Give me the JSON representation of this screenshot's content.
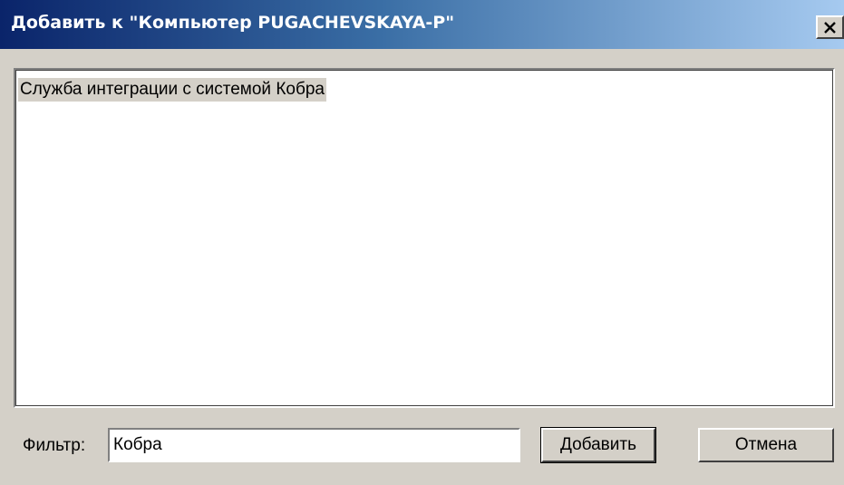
{
  "window": {
    "title": "Добавить к \"Компьютер PUGACHEVSKAYA-P\"",
    "close_icon": "close-icon"
  },
  "list": {
    "items": [
      {
        "label": "Служба интеграции с системой Кобра",
        "selected": true
      }
    ]
  },
  "filter": {
    "label": "Фильтр:",
    "value": "Кобра"
  },
  "buttons": {
    "add_label": "Добавить",
    "cancel_label": "Отмена"
  },
  "colors": {
    "titlebar_start": "#0a246a",
    "titlebar_end": "#a6caf0",
    "face": "#d4d0c8",
    "selection": "#d4d0c8"
  }
}
